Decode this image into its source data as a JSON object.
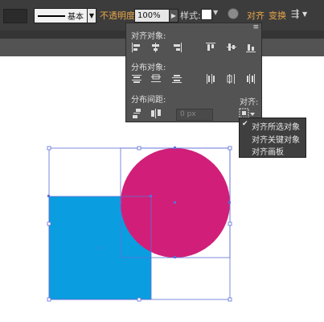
{
  "control_bar": {
    "stroke_profile_label": "基本",
    "opacity_label": "不透明度:",
    "opacity_value": "100%",
    "style_label": "样式:",
    "align_link": "对齐",
    "transform_link": "变换"
  },
  "align_panel": {
    "align_objects_title": "对齐对象:",
    "distribute_objects_title": "分布对象:",
    "distribute_spacing_title": "分布间距:",
    "spacing_value": "0 px",
    "align_to_label": "对齐:"
  },
  "align_to_menu": {
    "items": [
      {
        "label": "对齐所选对象",
        "checked": true
      },
      {
        "label": "对齐关键对象",
        "checked": false
      },
      {
        "label": "对齐画板",
        "checked": false
      }
    ]
  },
  "colors": {
    "rectangle_fill": "#0a9ee0",
    "circle_fill": "#d11f79",
    "selection": "#5e6fd6",
    "accent_text": "#e8a64a"
  }
}
